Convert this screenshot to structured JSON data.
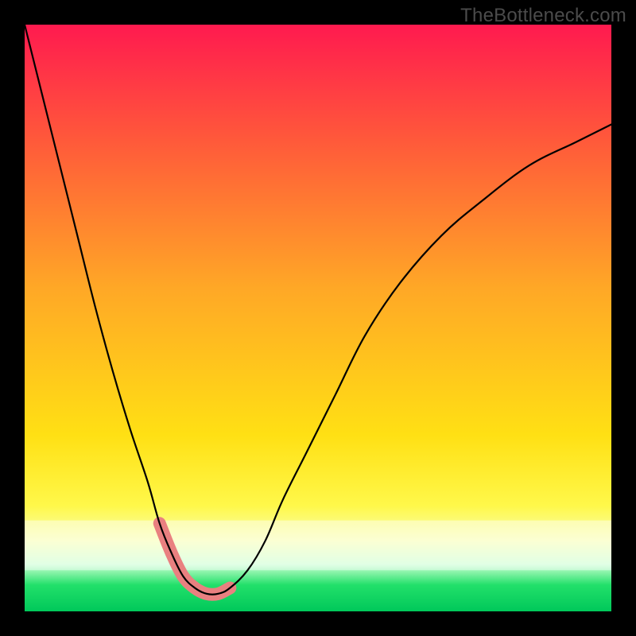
{
  "watermark": "TheBottleneck.com",
  "chart_data": {
    "type": "line",
    "title": "",
    "xlabel": "",
    "ylabel": "",
    "xlim": [
      0,
      100
    ],
    "ylim": [
      0,
      100
    ],
    "gradient_bands": [
      {
        "color": "#ff1a4f",
        "stop": 0.0
      },
      {
        "color": "#ff5a3a",
        "stop": 0.2
      },
      {
        "color": "#ffa826",
        "stop": 0.45
      },
      {
        "color": "#ffe014",
        "stop": 0.7
      },
      {
        "color": "#fff84a",
        "stop": 0.82
      },
      {
        "color": "#f7ffb0",
        "stop": 0.88
      },
      {
        "color": "#c8ffd0",
        "stop": 0.92
      },
      {
        "color": "#22e06a",
        "stop": 0.955
      },
      {
        "color": "#00c85a",
        "stop": 1.0
      }
    ],
    "series": [
      {
        "name": "bottleneck-curve",
        "x": [
          0,
          3,
          6,
          9,
          12,
          15,
          18,
          21,
          23,
          25,
          27,
          29,
          31,
          33,
          35,
          38,
          41,
          44,
          48,
          53,
          58,
          64,
          71,
          78,
          86,
          94,
          100
        ],
        "values": [
          100,
          88,
          76,
          64,
          52,
          41,
          31,
          22,
          15,
          10,
          6,
          4,
          3,
          3,
          4,
          7,
          12,
          19,
          27,
          37,
          47,
          56,
          64,
          70,
          76,
          80,
          83
        ]
      }
    ],
    "markers": {
      "name": "highlight-segment",
      "color": "#e98080",
      "points_x": [
        23,
        25,
        27,
        29,
        31,
        33,
        35
      ],
      "points_y": [
        15,
        10,
        6,
        4,
        3,
        3,
        4
      ]
    }
  }
}
